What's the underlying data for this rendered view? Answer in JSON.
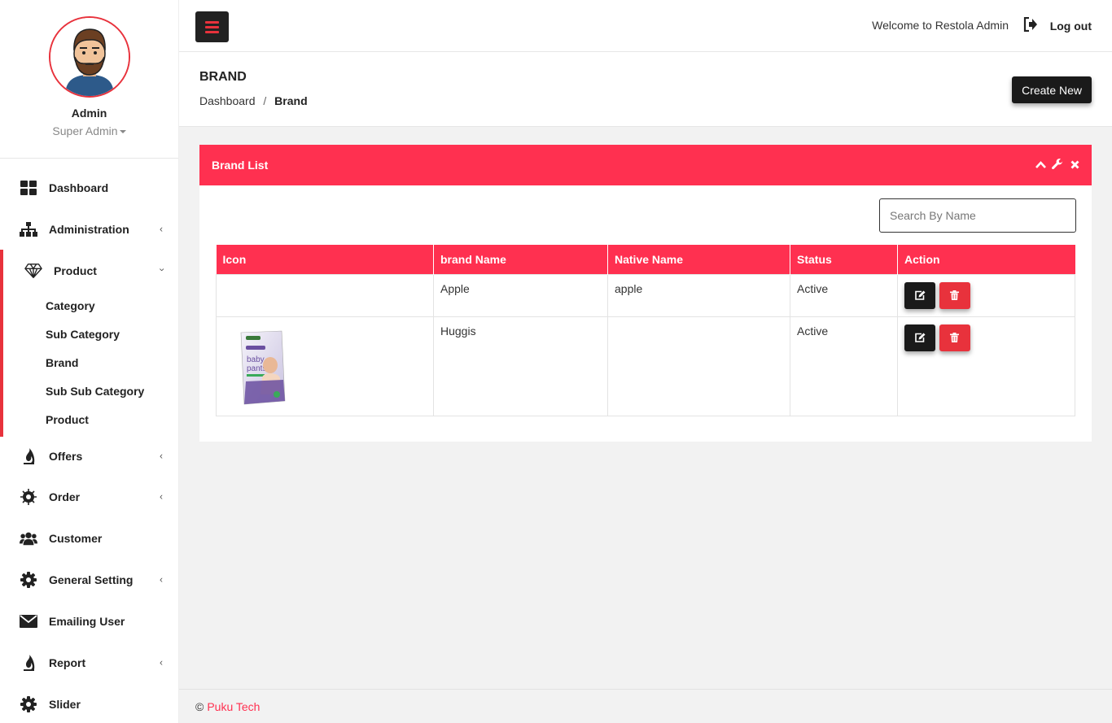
{
  "profile": {
    "name": "Admin",
    "role": "Super Admin"
  },
  "sidebar": {
    "items": [
      {
        "label": "Dashboard",
        "icon": "dashboard-grid-icon",
        "has_children": false
      },
      {
        "label": "Administration",
        "icon": "sitemap-icon",
        "has_children": true
      },
      {
        "label": "Product",
        "icon": "diamond-icon",
        "has_children": true,
        "expanded": true,
        "children": [
          "Category",
          "Sub Category",
          "Brand",
          "Sub Sub Category",
          "Product"
        ]
      },
      {
        "label": "Offers",
        "icon": "fire-icon",
        "has_children": true
      },
      {
        "label": "Order",
        "icon": "spinner-icon",
        "has_children": true
      },
      {
        "label": "Customer",
        "icon": "users-icon",
        "has_children": false
      },
      {
        "label": "General Setting",
        "icon": "gear-icon",
        "has_children": true
      },
      {
        "label": "Emailing User",
        "icon": "envelope-icon",
        "has_children": false
      },
      {
        "label": "Report",
        "icon": "fire-icon",
        "has_children": true
      },
      {
        "label": "Slider",
        "icon": "gear-icon",
        "has_children": false
      }
    ]
  },
  "topbar": {
    "welcome": "Welcome to Restola Admin",
    "logout": "Log out"
  },
  "page": {
    "title": "BRAND",
    "breadcrumb": {
      "home": "Dashboard",
      "separator": "/",
      "current": "Brand"
    },
    "create_button": "Create New"
  },
  "card": {
    "title": "Brand List",
    "search_placeholder": "Search By Name",
    "columns": [
      "Icon",
      "brand Name",
      "Native Name",
      "Status",
      "Action"
    ],
    "rows": [
      {
        "icon": "",
        "brand_name": "Apple",
        "native_name": "apple",
        "status": "Active"
      },
      {
        "icon": "diaper-package-image",
        "brand_name": "Huggis",
        "native_name": "",
        "status": "Active"
      }
    ]
  },
  "footer": {
    "copyright": "©",
    "company": "Puku Tech"
  },
  "colors": {
    "accent": "#ff3050",
    "danger": "#e8323c",
    "dark": "#1a1a1a"
  }
}
